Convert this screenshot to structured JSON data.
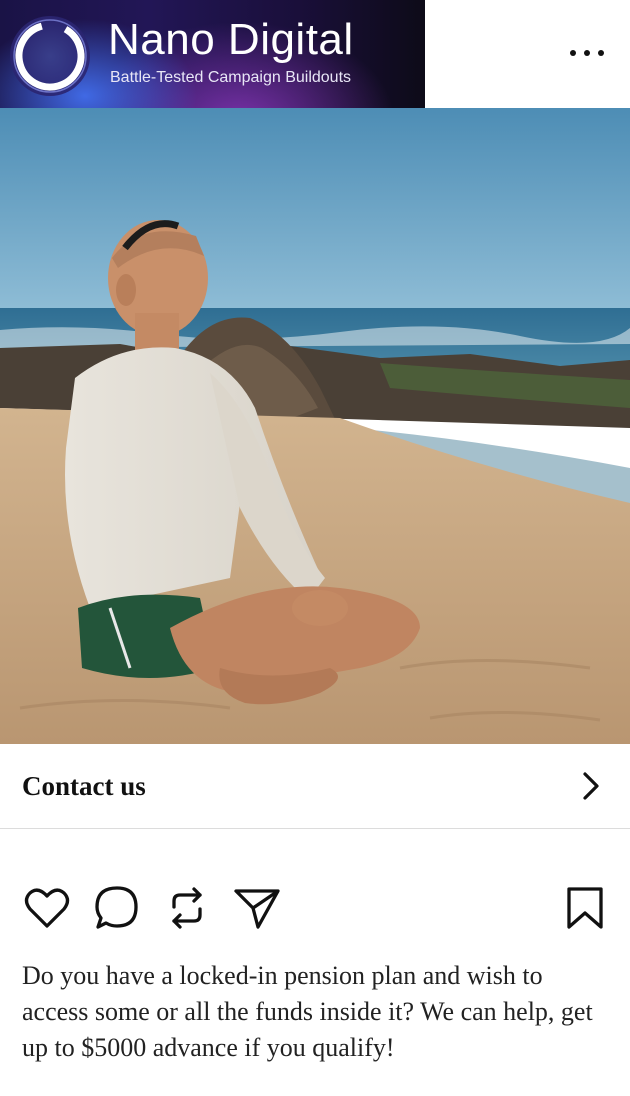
{
  "post": {
    "brand_name": "Nano Digital",
    "brand_tagline": "Battle-Tested Campaign Buildouts",
    "cta_label": "Contact us",
    "caption": "Do you have a locked-in pension plan and wish to access some or all the funds inside it? We can help, get up to $5000 advance if you qualify!"
  },
  "icons": {
    "more": "more-horizontal-icon",
    "cta": "chevron-right-icon",
    "like": "heart-icon",
    "comment": "comment-icon",
    "repost": "repost-icon",
    "share": "send-icon",
    "save": "bookmark-icon"
  },
  "colors": {
    "brand_bg_dark": "#1a1346",
    "brand_accent_blue": "#4678ff",
    "brand_accent_purple": "#963cc8",
    "text": "#111111"
  }
}
